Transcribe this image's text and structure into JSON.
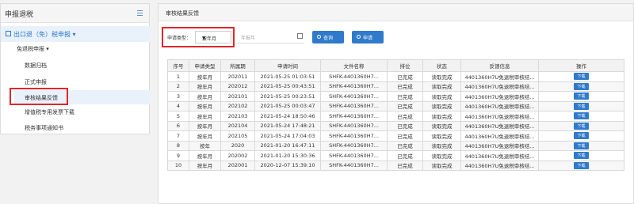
{
  "sidebar": {
    "title": "申报退税",
    "group": "出口退（免）税申报",
    "sub_menu": "免退税申报",
    "items": [
      "数据归档",
      "正式申报",
      "审核结果反馈"
    ],
    "more": [
      "增值税专用发票下载",
      "税务事项通知书"
    ]
  },
  "main": {
    "title": "审核结果反馈",
    "filter": {
      "label": "申请类型：",
      "select_value": "按年月",
      "date_placeholder": "年报年",
      "query_button": "查询",
      "apply_button": "申请"
    },
    "table": {
      "headers": [
        "序号",
        "申请类型",
        "所属期",
        "申请时间",
        "文件名称",
        "排位",
        "状态",
        "反馈信息",
        "操作"
      ],
      "download_label": "下载",
      "rows": [
        [
          "1",
          "按年月",
          "202011",
          "2021-05-25 01:03:51",
          "SHFK-4401360H7...",
          "已完成",
          "读取完成",
          "4401360H7U免退税审核结..."
        ],
        [
          "2",
          "按年月",
          "202012",
          "2021-05-25 00:43:51",
          "SHFK-4401360H7...",
          "已完成",
          "读取完成",
          "4401360H7U免退税审核结..."
        ],
        [
          "3",
          "按年月",
          "202101",
          "2021-05-25 00:23:51",
          "SHFK-4401360H7...",
          "已完成",
          "读取完成",
          "4401360H7U免退税审核结..."
        ],
        [
          "4",
          "按年月",
          "202102",
          "2021-05-25 00:03:47",
          "SHFK-4401360H7...",
          "已完成",
          "读取完成",
          "4401360H7U免退税审核结..."
        ],
        [
          "5",
          "按年月",
          "202103",
          "2021-05-24 18:50:46",
          "SHFK-4401360H7...",
          "已完成",
          "读取完成",
          "4401360H7U免退税审核结..."
        ],
        [
          "6",
          "按年月",
          "202104",
          "2021-05-24 17:48:21",
          "SHFK-4401360H7...",
          "已完成",
          "读取完成",
          "4401360H7U免退税审核结..."
        ],
        [
          "7",
          "按年月",
          "202105",
          "2021-05-24 17:04:03",
          "SHFK-4401360H7...",
          "已完成",
          "读取完成",
          "4401360H7U免退税审核结..."
        ],
        [
          "8",
          "按年",
          "2020",
          "2021-01-20 16:47:11",
          "SHFK-4401360H7...",
          "已完成",
          "读取完成",
          "4401360H7U免退税审核结..."
        ],
        [
          "9",
          "按年月",
          "202002",
          "2021-01-20 15:30:36",
          "SHFK-4401360H7...",
          "已完成",
          "读取完成",
          "4401360H7U免退税审核结..."
        ],
        [
          "10",
          "按年月",
          "202001",
          "2020-12-07 15:39:10",
          "SHFK-4401360H7...",
          "已完成",
          "读取完成",
          "4401360H7U免退税审核结..."
        ]
      ]
    }
  },
  "colors": {
    "accent": "#2f7acb",
    "highlight": "#e3262a"
  }
}
